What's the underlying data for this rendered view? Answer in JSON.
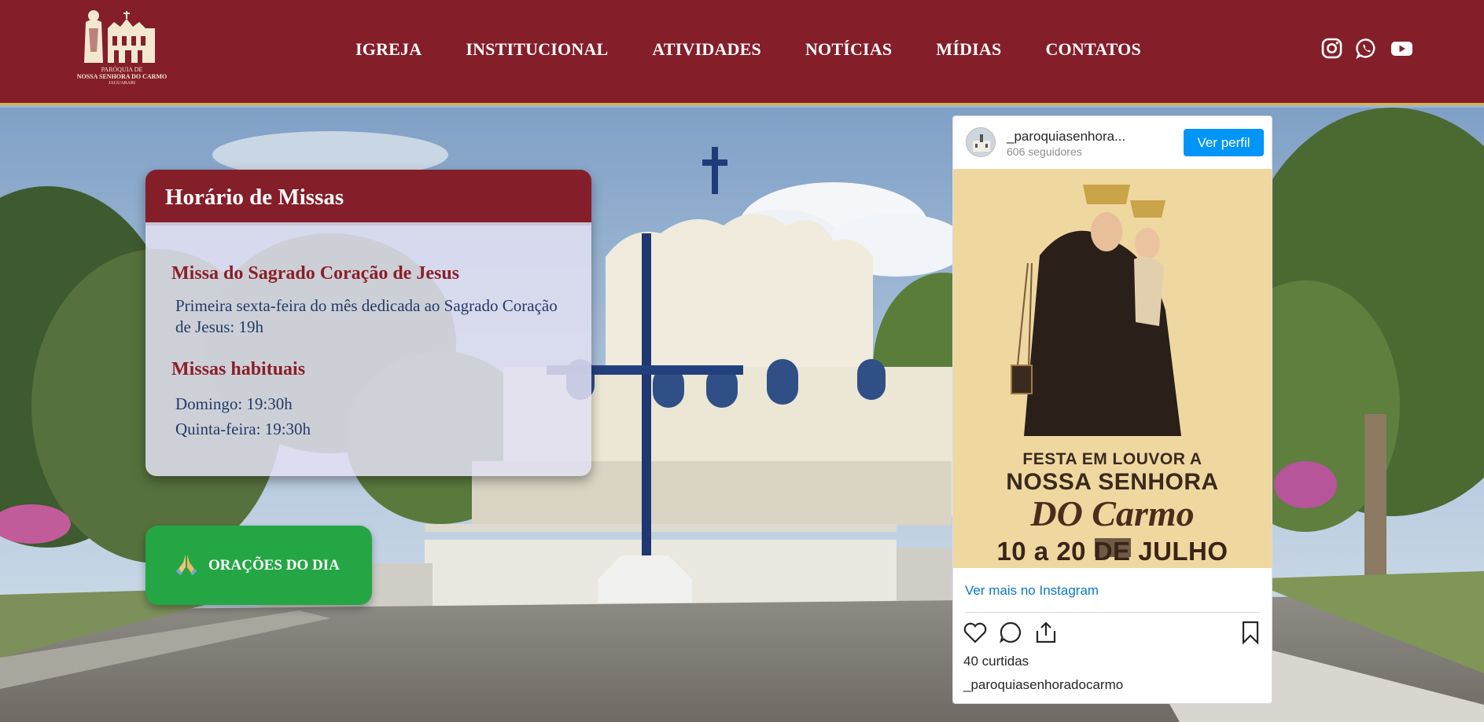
{
  "logo": {
    "line1": "PARÓQUIA DE",
    "line2": "NOSSA SENHORA DO CARMO",
    "line3": "JAGUARARI"
  },
  "nav": {
    "items": [
      "IGREJA",
      "INSTITUCIONAL",
      "ATIVIDADES",
      "NOTÍCIAS",
      "MÍDIAS",
      "CONTATOS"
    ]
  },
  "social": [
    "instagram-icon",
    "whatsapp-icon",
    "youtube-icon"
  ],
  "mass_schedule": {
    "title": "Horário de Missas",
    "section1_title": "Missa do Sagrado Coração de Jesus",
    "section1_text": "Primeira sexta-feira do mês dedicada ao Sagrado Coração de Jesus: 19h",
    "section2_title": "Missas habituais",
    "section2_line1": "Domingo: 19:30h",
    "section2_line2": "Quinta-feira: 19:30h"
  },
  "prayer_button": {
    "label": "ORAÇÕES DO DIA",
    "icon": "praying-hands-icon"
  },
  "instagram": {
    "username": "_paroquiasenhora...",
    "followers": "606 seguidores",
    "follow_label": "Ver perfil",
    "post_line1": "FESTA EM LOUVOR A",
    "post_line2": "NOSSA SENHORA",
    "post_line3": "DO Carmo",
    "post_line4": "10 a 20 DE JULHO",
    "more_label": "Ver mais no Instagram",
    "likes": "40 curtidas",
    "handle": "_paroquiasenhoradocarmo"
  },
  "colors": {
    "brand": "#841e29",
    "accent_border": "#d9b44a",
    "prayer_green": "#25a645",
    "insta_blue": "#0095f6"
  }
}
